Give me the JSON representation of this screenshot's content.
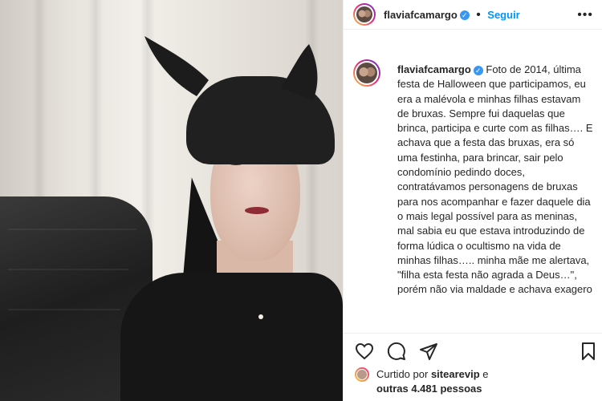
{
  "post": {
    "username": "flaviafcamargo",
    "follow_label": "Seguir",
    "caption_text": "Foto de 2014, última festa de Halloween que participamos, eu era a malévola e minhas filhas estavam de bruxas. Sempre fui daquelas que brinca, participa e curte com as filhas…. E achava que a festa das bruxas, era só uma festinha, para brincar, sair pelo condomínio pedindo doces, contratávamos personagens de bruxas para nos acompanhar e fazer daquele dia o mais legal possível para as meninas, mal sabia eu que estava introduzindo de forma lúdica o ocultismo na vida de minhas filhas….. minha mãe me alertava, \"filha esta festa não agrada a Deus…\", porém não via maldade e achava exagero",
    "likes": {
      "prefix": "Curtido por",
      "liker": "sitearevip",
      "joiner": "e",
      "others": "outras 4.481 pessoas"
    }
  },
  "icons": {
    "verified": "verified-badge-icon",
    "like": "heart-icon",
    "comment": "comment-icon",
    "share": "send-icon",
    "save": "bookmark-icon",
    "more": "more-options-icon"
  },
  "colors": {
    "link_blue": "#0095f6",
    "verified_blue": "#3897f0",
    "text": "#262626",
    "divider": "#efefef"
  }
}
